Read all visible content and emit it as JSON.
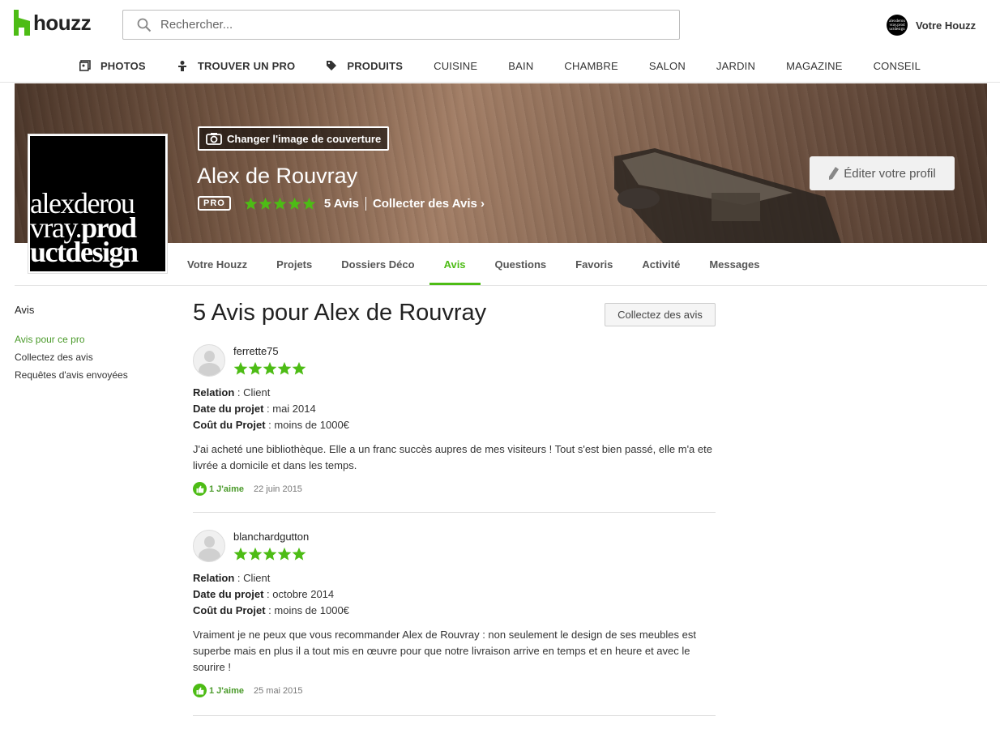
{
  "header": {
    "logo_text": "houzz",
    "search_placeholder": "Rechercher...",
    "user_label": "Votre Houzz",
    "user_avatar_text": "alexderou vray.prod uctdesign"
  },
  "nav": [
    {
      "label": "PHOTOS",
      "icon": "photos-icon",
      "bold": true
    },
    {
      "label": "TROUVER UN PRO",
      "icon": "pro-icon",
      "bold": true
    },
    {
      "label": "PRODUITS",
      "icon": "tag-icon",
      "bold": true
    },
    {
      "label": "CUISINE"
    },
    {
      "label": "BAIN"
    },
    {
      "label": "CHAMBRE"
    },
    {
      "label": "SALON"
    },
    {
      "label": "JARDIN"
    },
    {
      "label": "MAGAZINE"
    },
    {
      "label": "CONSEIL"
    }
  ],
  "profile": {
    "change_cover_label": "Changer l'image de couverture",
    "name": "Alex de Rouvray",
    "pro_badge": "PRO",
    "rating": 5,
    "reviews_count": "5 Avis",
    "collect_link": "Collecter des Avis ›",
    "edit_label": "Éditer votre profil",
    "pic_lines": [
      "alexderou",
      "vray.",
      "prod",
      "uctdesign"
    ]
  },
  "tabs": [
    {
      "label": "Votre Houzz"
    },
    {
      "label": "Projets"
    },
    {
      "label": "Dossiers Déco"
    },
    {
      "label": "Avis",
      "active": true
    },
    {
      "label": "Questions"
    },
    {
      "label": "Favoris"
    },
    {
      "label": "Activité"
    },
    {
      "label": "Messages"
    }
  ],
  "sidebar": {
    "title": "Avis",
    "links": [
      {
        "label": "Avis pour ce pro",
        "active": true
      },
      {
        "label": "Collectez des avis"
      },
      {
        "label": "Requêtes d'avis envoyées"
      }
    ]
  },
  "main": {
    "title": "5 Avis pour Alex de Rouvray",
    "collect_button": "Collectez des avis",
    "field_labels": {
      "relation": "Relation",
      "date": "Date du projet",
      "cost": "Coût du Projet"
    },
    "reviews": [
      {
        "user": "ferrette75",
        "rating": 5,
        "relation": "Client",
        "date": "mai 2014",
        "cost": "moins de 1000€",
        "text": "J'ai acheté une bibliothèque. Elle a un franc succès aupres de mes visiteurs ! Tout s'est bien passé, elle m'a ete livrée a domicile et dans les temps.",
        "likes": "1 J'aime",
        "posted": "22 juin 2015"
      },
      {
        "user": "blanchardgutton",
        "rating": 5,
        "relation": "Client",
        "date": "octobre 2014",
        "cost": "moins de 1000€",
        "text": "Vraiment je ne peux que vous recommander Alex de Rouvray : non seulement le design de ses meubles est superbe mais en plus il a tout mis en œuvre pour que notre livraison arrive en temps et en heure et avec le sourire !",
        "likes": "1 J'aime",
        "posted": "25 mai 2015"
      }
    ]
  },
  "colors": {
    "accent": "#4dbc15",
    "star": "#4dbc15"
  }
}
